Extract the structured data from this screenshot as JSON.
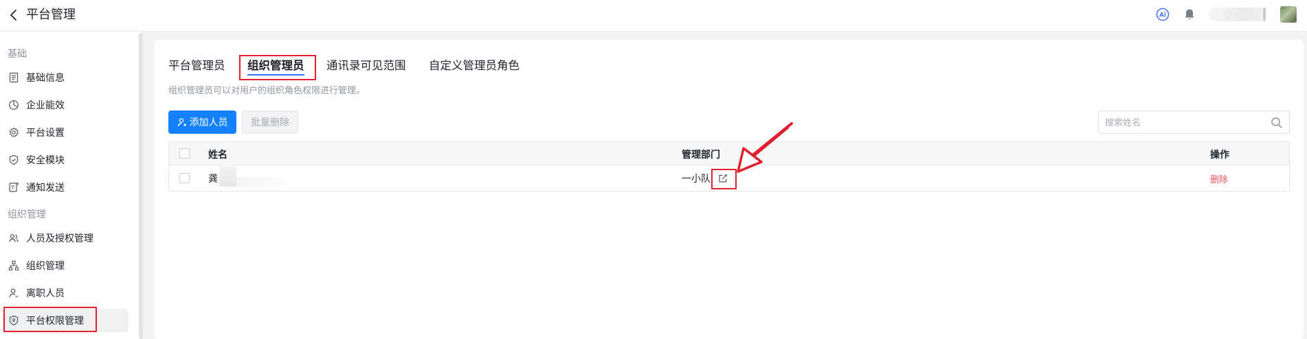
{
  "header": {
    "back_icon": "chevron-left-icon",
    "title": "平台管理",
    "icons": [
      "ai-icon",
      "bell-icon"
    ]
  },
  "sidebar": {
    "groups": [
      {
        "label": "基础",
        "items": [
          {
            "label": "基础信息",
            "icon": "document-icon"
          },
          {
            "label": "企业能效",
            "icon": "chart-pie-icon"
          },
          {
            "label": "平台设置",
            "icon": "gear-icon"
          },
          {
            "label": "安全模块",
            "icon": "shield-check-icon"
          },
          {
            "label": "通知发送",
            "icon": "send-notice-icon"
          }
        ]
      },
      {
        "label": "组织管理",
        "items": [
          {
            "label": "人员及授权管理",
            "icon": "users-icon"
          },
          {
            "label": "组织管理",
            "icon": "org-tree-icon"
          },
          {
            "label": "离职人员",
            "icon": "user-leave-icon"
          },
          {
            "label": "平台权限管理",
            "icon": "shield-permission-icon",
            "active": true
          }
        ]
      }
    ]
  },
  "tabs": [
    {
      "label": "平台管理员"
    },
    {
      "label": "组织管理员",
      "active": true
    },
    {
      "label": "通讯录可见范围"
    },
    {
      "label": "自定义管理员角色"
    }
  ],
  "description": "组织管理员可以对用户的组织角色权限进行管理。",
  "toolbar": {
    "add_label": "添加人员",
    "batch_delete_label": "批量删除"
  },
  "search": {
    "placeholder": "搜索姓名",
    "value": ""
  },
  "table": {
    "columns": [
      "姓名",
      "管理部门",
      "操作"
    ],
    "rows": [
      {
        "name": "龚",
        "department": "一小队",
        "action": "删除"
      }
    ]
  },
  "colors": {
    "primary": "#1482ff",
    "tab_underline": "#3370ff",
    "danger": "#f5555e",
    "annotation": "#e0202e"
  }
}
